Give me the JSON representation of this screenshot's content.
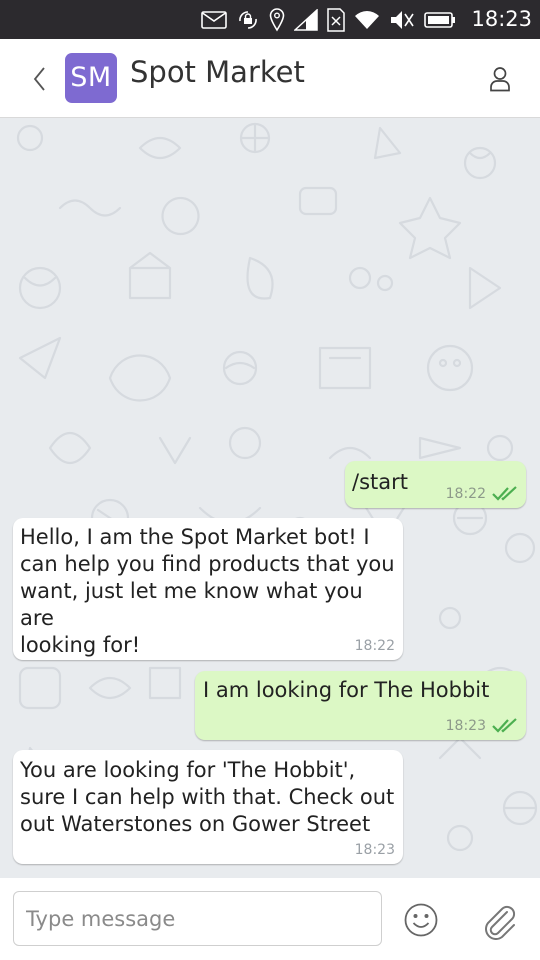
{
  "status_bar": {
    "time": "18:23",
    "icons": [
      "mail-icon",
      "rotation-lock-icon",
      "location-icon",
      "signal-icon",
      "no-sim-icon",
      "wifi-icon",
      "volume-muted-icon",
      "battery-icon"
    ]
  },
  "header": {
    "avatar_initials": "SM",
    "title": "Spot Market",
    "avatar_color": "#7e6ad1"
  },
  "messages": [
    {
      "direction": "out",
      "text": "/start",
      "time": "18:22",
      "status": "read"
    },
    {
      "direction": "in",
      "text": "Hello, I am the Spot Market bot! I\ncan help you find products that you\nwant, just let me know what you are\nlooking for!",
      "time": "18:22"
    },
    {
      "direction": "out",
      "text": "I am looking for The Hobbit",
      "time": "18:23",
      "status": "read"
    },
    {
      "direction": "in",
      "text": "You are looking for 'The Hobbit',\nsure I can help with that. Check out\nout Waterstones on Gower Street",
      "time": "18:23"
    }
  ],
  "input": {
    "placeholder": "Type message",
    "value": ""
  },
  "colors": {
    "outgoing_bubble": "#dcf8c5",
    "incoming_bubble": "#ffffff",
    "chat_background": "#e8ebee",
    "read_check": "#4caf50"
  }
}
